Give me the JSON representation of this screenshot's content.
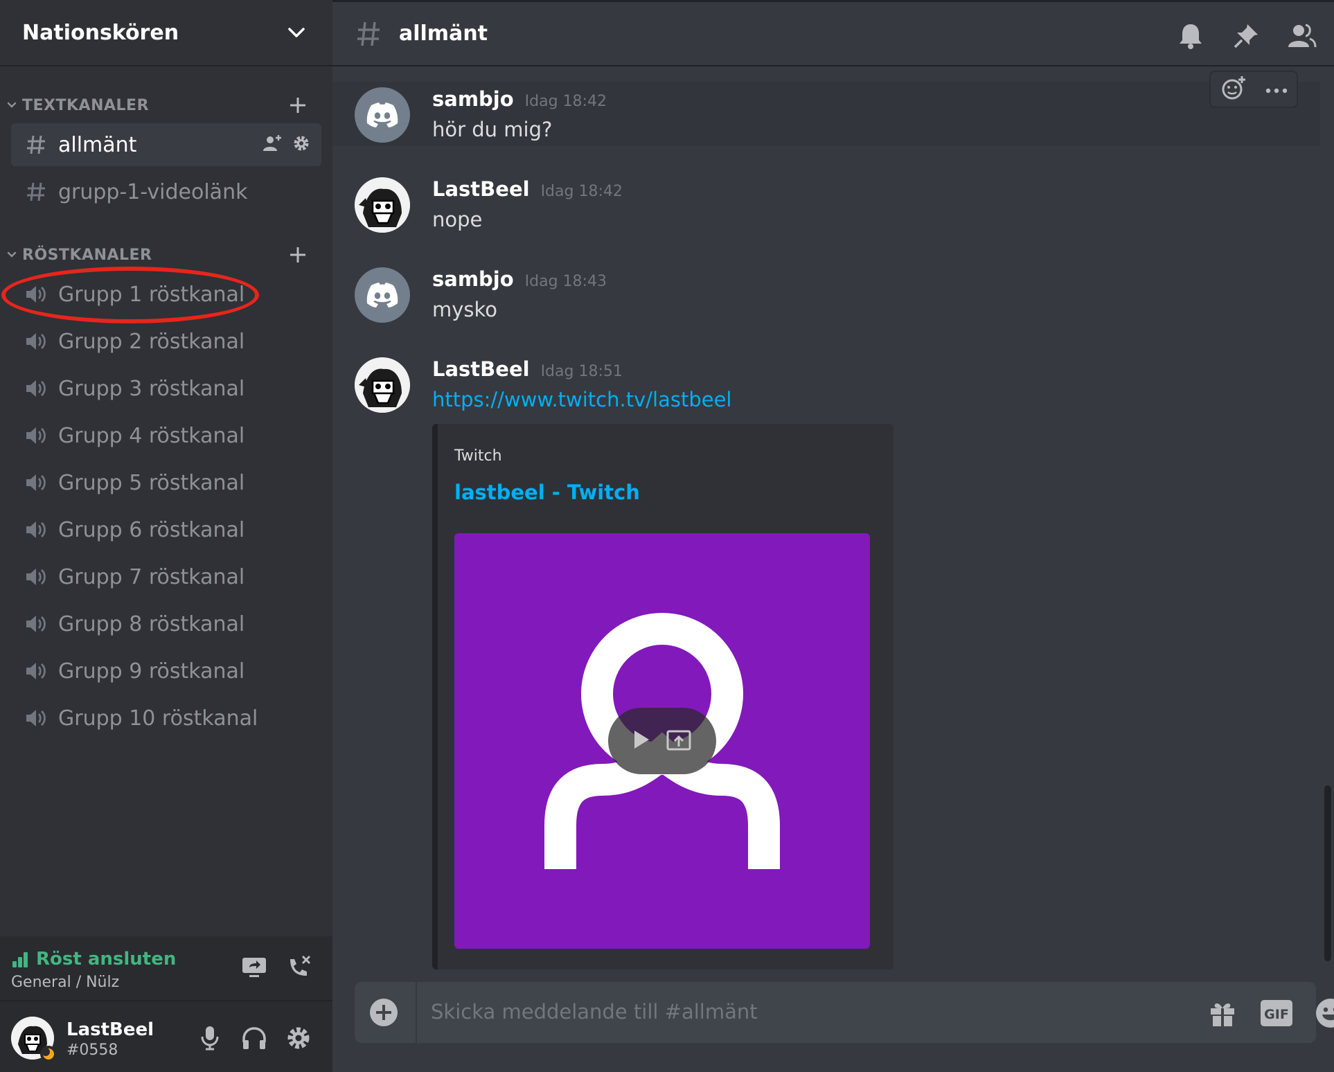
{
  "server": {
    "name": "Nationskören"
  },
  "categories": {
    "text": "TEXTKANALER",
    "voice": "RÖSTKANALER"
  },
  "text_channels": [
    {
      "label": "allmänt",
      "active": true
    },
    {
      "label": "grupp-1-videolänk",
      "active": false
    }
  ],
  "voice_channels": [
    "Grupp 1 röstkanal",
    "Grupp 2 röstkanal",
    "Grupp 3 röstkanal",
    "Grupp 4 röstkanal",
    "Grupp 5 röstkanal",
    "Grupp 6 röstkanal",
    "Grupp 7 röstkanal",
    "Grupp 8 röstkanal",
    "Grupp 9 röstkanal",
    "Grupp 10 röstkanal"
  ],
  "voice_panel": {
    "status": "Röst ansluten",
    "location": "General / Nülz"
  },
  "user": {
    "name": "LastBeel",
    "tag": "#0558"
  },
  "channel_header": {
    "name": "allmänt"
  },
  "messages": [
    {
      "author": "sambjo",
      "time": "Idag 18:42",
      "text": "hör du mig?",
      "avatar": "discord"
    },
    {
      "author": "LastBeel",
      "time": "Idag 18:42",
      "text": "nope",
      "avatar": "picture"
    },
    {
      "author": "sambjo",
      "time": "Idag 18:43",
      "text": "mysko",
      "avatar": "discord"
    },
    {
      "author": "LastBeel",
      "time": "Idag 18:51",
      "text": "https://www.twitch.tv/lastbeel",
      "avatar": "picture"
    }
  ],
  "embed": {
    "provider": "Twitch",
    "title": "lastbeel - Twitch",
    "thumbnail_color": "#8219bb"
  },
  "composer": {
    "placeholder": "Skicka meddelande till #allmänt",
    "gif_label": "GIF"
  },
  "colors": {
    "accent_link": "#00b0f4",
    "voice_connected": "#43b581",
    "highlight_ring": "#e8251b"
  }
}
